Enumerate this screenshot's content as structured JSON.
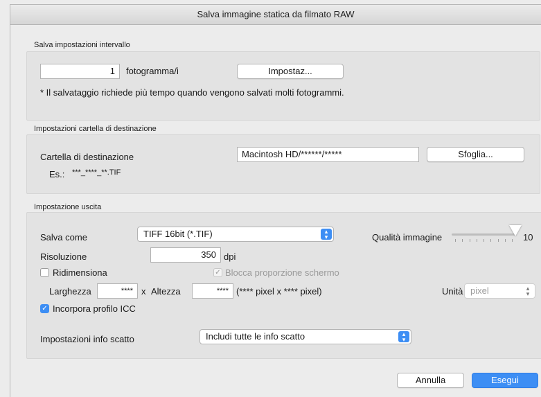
{
  "window": {
    "title": "Salva immagine statica da filmato RAW"
  },
  "interval": {
    "section_label": "Salva impostazioni intervallo",
    "frames_value": "1",
    "frames_unit": "fotogramma/i",
    "settings_button": "Impostaz...",
    "note": "* Il salvataggio richiede più tempo quando vengono salvati molti fotogrammi."
  },
  "destination": {
    "section_label": "Impostazioni cartella di destinazione",
    "folder_label": "Cartella di destinazione",
    "folder_value": "Macintosh HD/******/*****",
    "browse_button": "Sfoglia...",
    "example_label": "Es.:",
    "example_value": "***_****_**.TIF"
  },
  "output": {
    "section_label": "Impostazione uscita",
    "save_as_label": "Salva come",
    "save_as_value": "TIFF 16bit (*.TIF)",
    "quality_label": "Qualità immagine",
    "quality_value": "10",
    "quality_level": 10,
    "quality_max": 10,
    "resolution_label": "Risoluzione",
    "resolution_value": "350",
    "resolution_unit": "dpi",
    "resize_label": "Ridimensiona",
    "resize_checked": false,
    "lock_ratio_label": "Blocca proporzione schermo",
    "lock_ratio_checked": true,
    "width_label": "Larghezza",
    "width_value": "****",
    "times_label": "x",
    "height_label": "Altezza",
    "height_value": "****",
    "pixel_info": "(**** pixel x **** pixel)",
    "unit_label": "Unità",
    "unit_value": "pixel",
    "icc_label": "Incorpora profilo ICC",
    "icc_checked": true,
    "shot_info_label": "Impostazioni info scatto",
    "shot_info_value": "Includi tutte le info scatto"
  },
  "footer": {
    "cancel_button": "Annulla",
    "execute_button": "Esegui"
  },
  "colors": {
    "accent": "#3d8ef4",
    "window_bg": "#ececec",
    "group_bg": "#e3e3e3"
  }
}
